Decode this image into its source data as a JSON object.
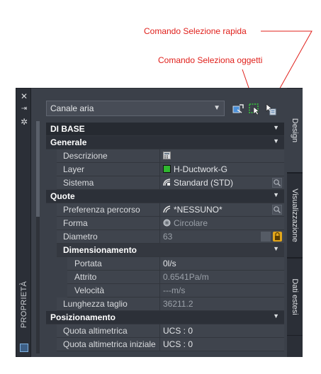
{
  "annotations": {
    "quick_select": "Comando Selezione rapida",
    "select_objects": "Comando Seleziona oggetti"
  },
  "palette": {
    "title": "PROPRIETÀ",
    "object_type": "Canale aria",
    "tabs": [
      "Design",
      "Visualizzazione",
      "Dati estesi"
    ]
  },
  "grid": {
    "rows": [
      {
        "kind": "cat0",
        "label": "DI BASE"
      },
      {
        "kind": "cat",
        "label": "Generale"
      },
      {
        "kind": "prop",
        "label": "Descrizione",
        "value": ""
      },
      {
        "kind": "prop",
        "label": "Layer",
        "value": "H-Ductwork-G"
      },
      {
        "kind": "prop",
        "label": "Sistema",
        "value": "Standard (STD)"
      },
      {
        "kind": "cat",
        "label": "Quote"
      },
      {
        "kind": "prop",
        "label": "Preferenza percorso",
        "value": "*NESSUNO*"
      },
      {
        "kind": "prop",
        "label": "Forma",
        "value": "Circolare"
      },
      {
        "kind": "prop",
        "label": "Diametro",
        "value": "63"
      },
      {
        "kind": "sub",
        "label": "Dimensionamento"
      },
      {
        "kind": "prop2",
        "label": "Portata",
        "value": "0l/s"
      },
      {
        "kind": "prop2",
        "label": "Attrito",
        "value": "0.6541Pa/m"
      },
      {
        "kind": "prop2",
        "label": "Velocità",
        "value": "---m/s"
      },
      {
        "kind": "prop",
        "label": "Lunghezza taglio",
        "value": "36211.2"
      },
      {
        "kind": "cat",
        "label": "Posizionamento"
      },
      {
        "kind": "prop",
        "label": "Quota altimetrica",
        "value": "UCS : 0"
      },
      {
        "kind": "prop",
        "label": "Quota altimetrica iniziale",
        "value": "UCS : 0"
      }
    ]
  },
  "colors": {
    "annotation": "#e0201b",
    "panel_bg": "#3b4049",
    "layer_swatch": "#2fb82f",
    "lock": "#e2a61b"
  },
  "icons": [
    "close-icon",
    "auto-hide-icon",
    "settings-icon",
    "quick-select-icon",
    "select-objects-icon",
    "toggle-pickadd-icon",
    "calculator-icon",
    "system-icon",
    "routing-icon",
    "shape-icon",
    "lock-icon"
  ]
}
